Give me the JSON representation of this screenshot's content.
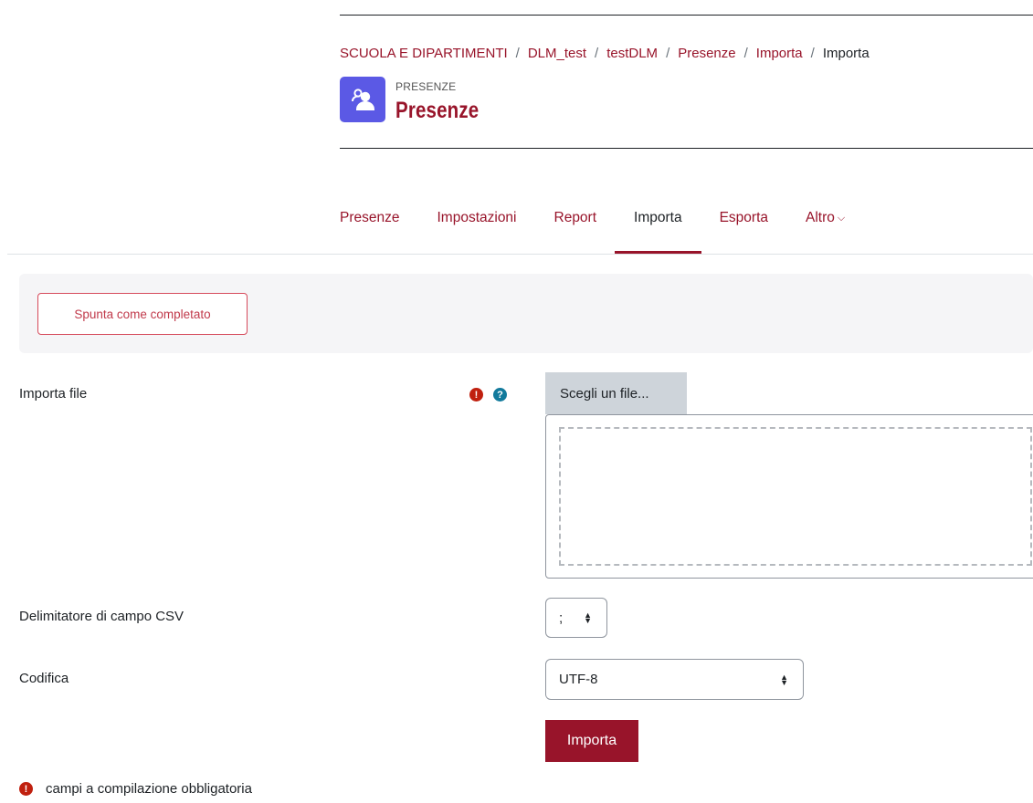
{
  "breadcrumb": {
    "items": [
      "SCUOLA E DIPARTIMENTI",
      "DLM_test",
      "testDLM",
      "Presenze",
      "Importa",
      "Importa"
    ],
    "separator": "/"
  },
  "header": {
    "module_kind": "PRESENZE",
    "title": "Presenze",
    "icon": "attendance-icon",
    "icon_color": "#5b59e5"
  },
  "nav": {
    "tabs": [
      {
        "label": "Presenze",
        "active": false
      },
      {
        "label": "Impostazioni",
        "active": false
      },
      {
        "label": "Report",
        "active": false
      },
      {
        "label": "Importa",
        "active": true
      },
      {
        "label": "Esporta",
        "active": false
      },
      {
        "label": "Altro",
        "active": false
      }
    ],
    "more_chevron": "⌄"
  },
  "completion": {
    "button_label": "Spunta come completato"
  },
  "form": {
    "file": {
      "label": "Importa file",
      "required_icon": "!",
      "help_icon": "?",
      "choose_label": "Scegli un file..."
    },
    "delimiter": {
      "label": "Delimitatore di campo CSV",
      "value": ";"
    },
    "encoding": {
      "label": "Codifica",
      "value": "UTF-8"
    },
    "submit_label": "Importa",
    "required_note": "campi a compilazione obbligatoria"
  },
  "colors": {
    "brand": "#98142a",
    "required": "#c0200f",
    "help": "#127a9c"
  }
}
